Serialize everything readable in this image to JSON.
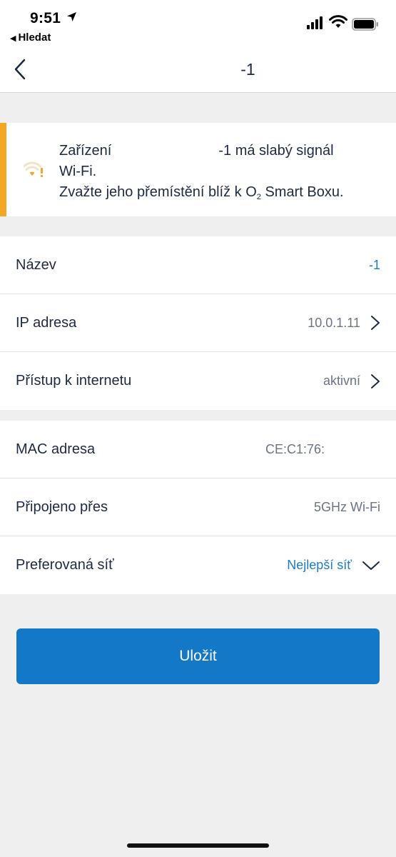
{
  "status_bar": {
    "time": "9:51",
    "back_app_label": "Hledat"
  },
  "nav": {
    "title": "-1"
  },
  "banner": {
    "line1_start": "Zařízení",
    "line1_end": "-1 má slabý signál",
    "line2": "Wi-Fi.",
    "line3_start": "Zvažte jeho přemístění blíž k O",
    "line3_sub": "2",
    "line3_end": " Smart Boxu.",
    "accent_color": "#f5a623"
  },
  "section1": {
    "name_label": "Název",
    "name_value": "-1",
    "ip_label": "IP adresa",
    "ip_value": "10.0.1.11",
    "internet_label": "Přístup k internetu",
    "internet_value": "aktivní"
  },
  "section2": {
    "mac_label": "MAC adresa",
    "mac_value": "CE:C1:76:",
    "via_label": "Připojeno přes",
    "via_value": "5GHz Wi-Fi",
    "network_label": "Preferovaná síť",
    "network_value": "Nejlepší síť"
  },
  "save_label": "Uložit",
  "colors": {
    "primary": "#1478c9",
    "link": "#1a7dc9",
    "warning": "#f5a623"
  }
}
